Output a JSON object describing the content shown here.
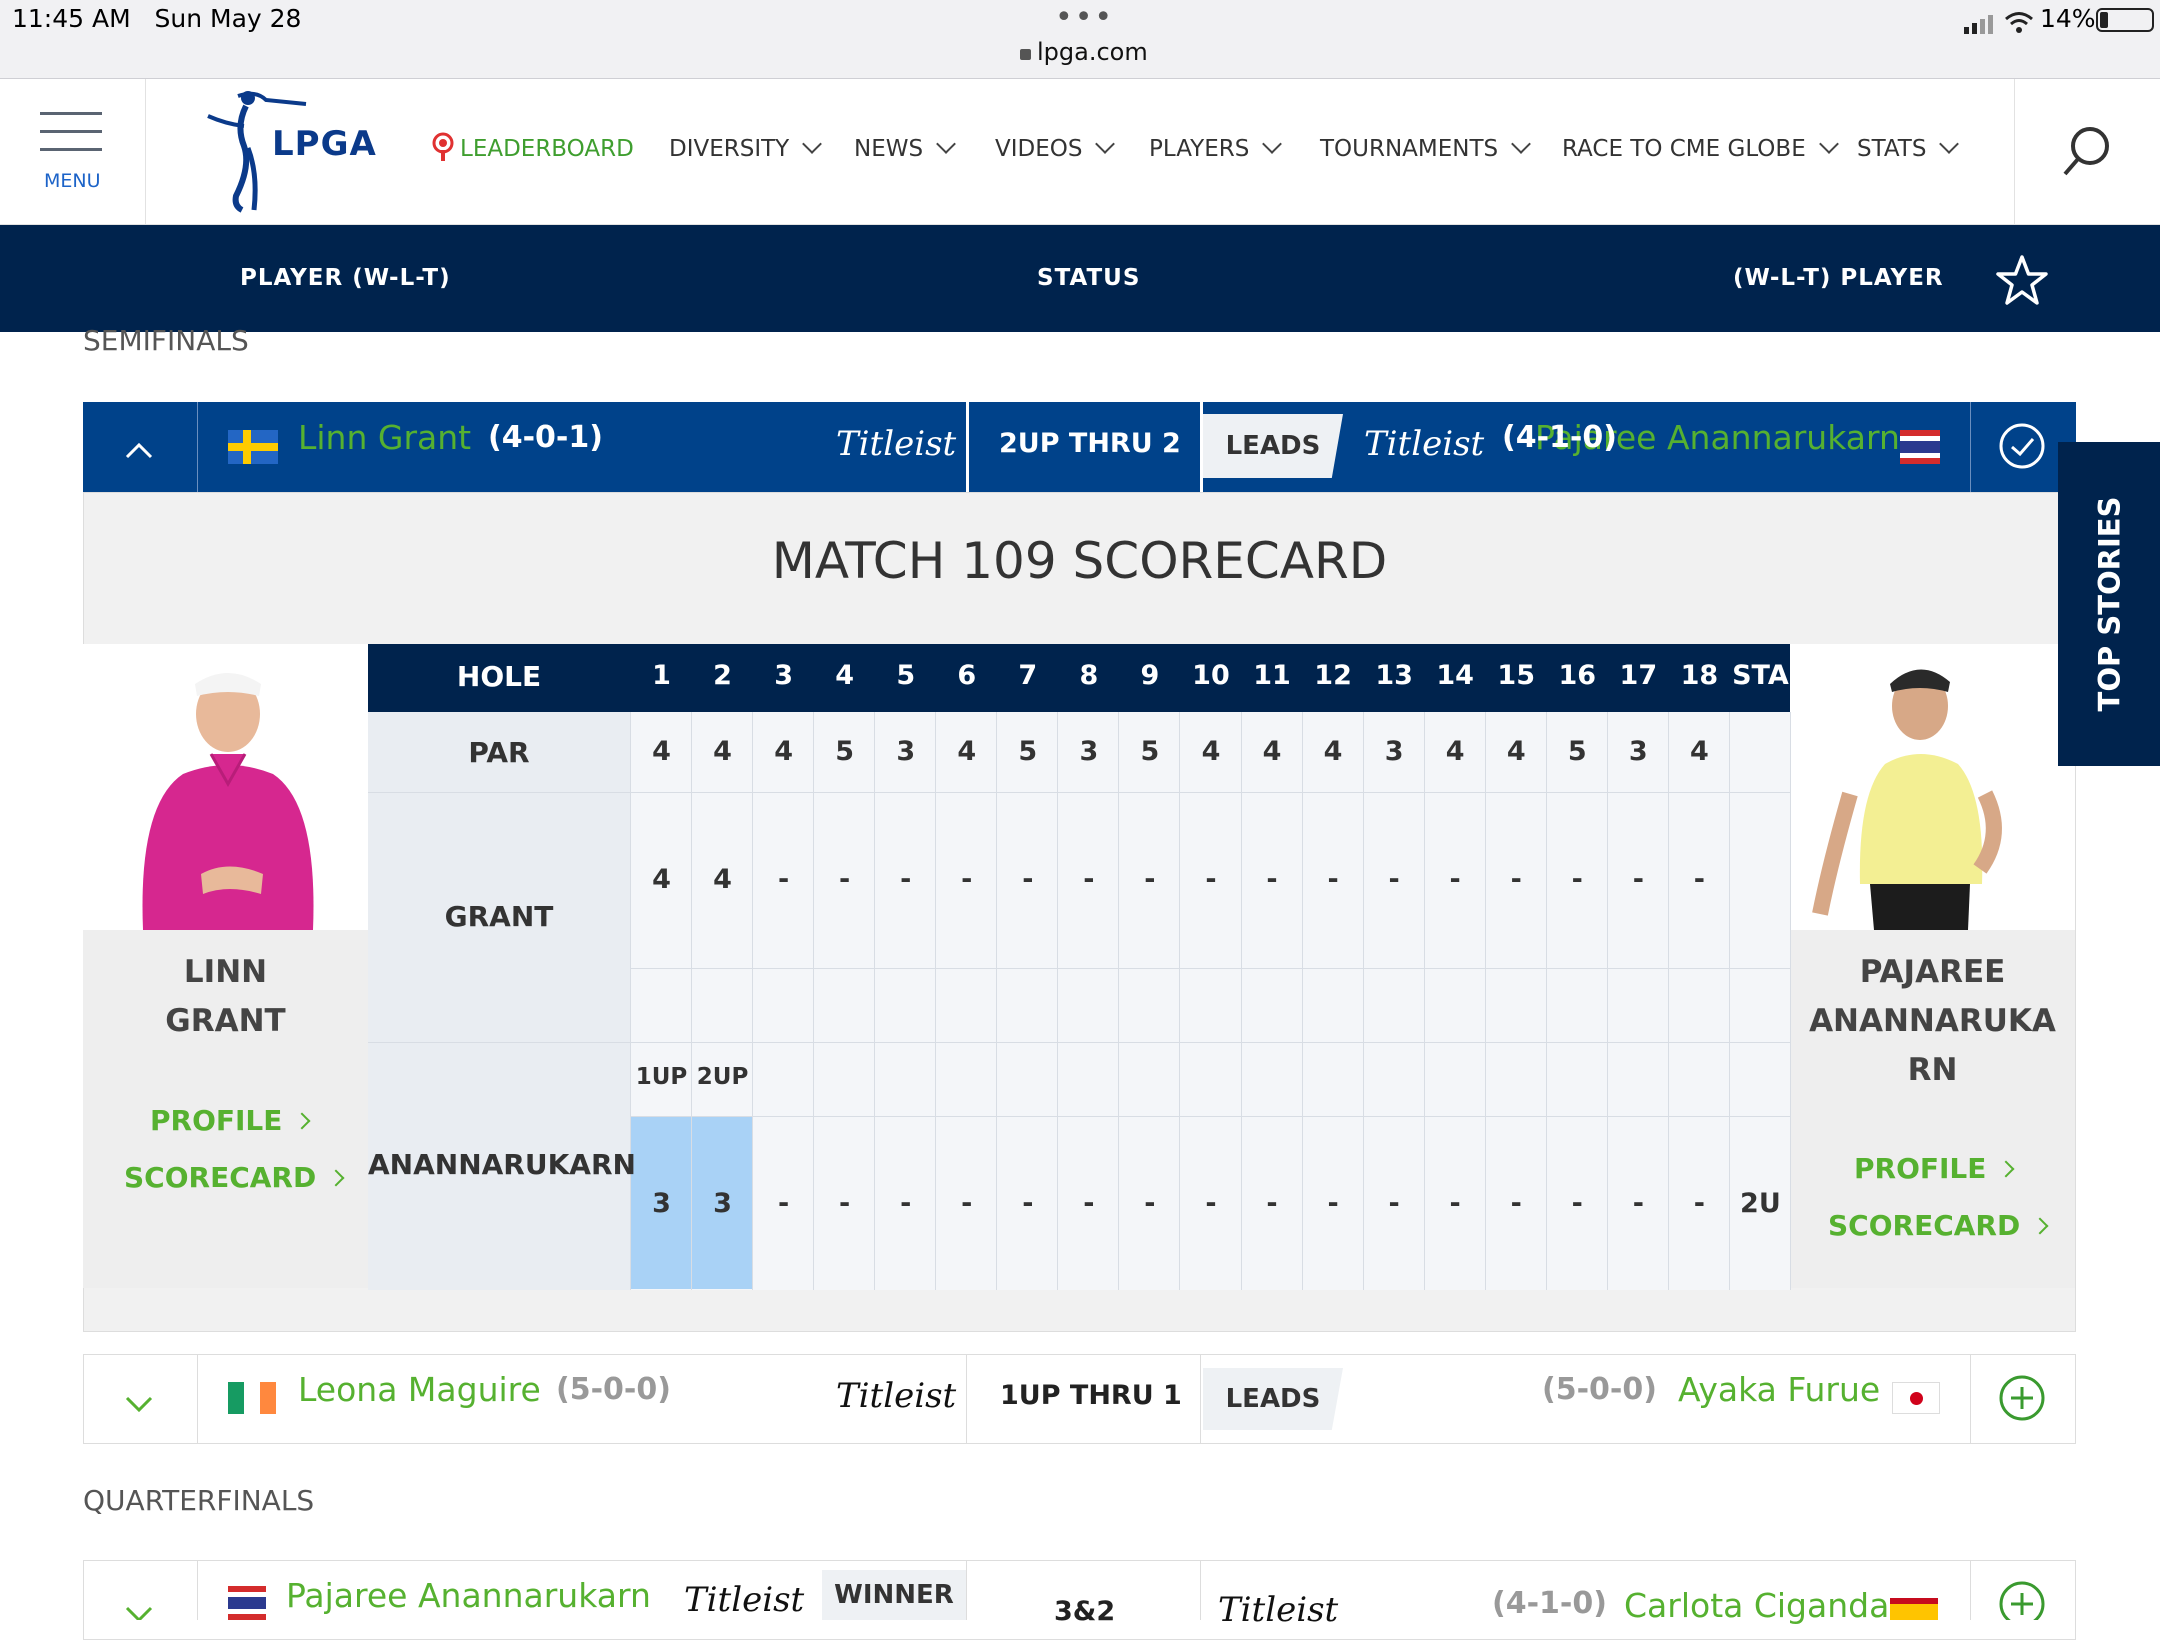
{
  "status_bar": {
    "time": "11:45 AM",
    "date": "Sun May 28",
    "dots": "•••",
    "url": "lpga.com",
    "battery": "14%"
  },
  "header": {
    "menu_label": "MENU",
    "logo_text": "LPGA",
    "nav": [
      {
        "label": "LEADERBOARD"
      },
      {
        "label": "DIVERSITY"
      },
      {
        "label": "NEWS"
      },
      {
        "label": "VIDEOS"
      },
      {
        "label": "PLAYERS"
      },
      {
        "label": "TOURNAMENTS"
      },
      {
        "label": "RACE TO CME GLOBE"
      },
      {
        "label": "STATS"
      }
    ]
  },
  "column_header": {
    "left": "PLAYER (W-L-T)",
    "center": "STATUS",
    "right": "(W-L-T) PLAYER"
  },
  "sections": {
    "semifinals": "SEMIFINALS",
    "quarterfinals": "QUARTERFINALS"
  },
  "match_open": {
    "player1": "Linn Grant",
    "record1": "(4-0-1)",
    "sponsor": "Titleist",
    "status": "2UP THRU 2",
    "badge": "LEADS",
    "record2": "(4-1-0)",
    "player2": "Pajaree Anannarukarn"
  },
  "scorecard": {
    "title": "MATCH 109 SCORECARD",
    "hole_label": "HOLE",
    "holes": [
      "1",
      "2",
      "3",
      "4",
      "5",
      "6",
      "7",
      "8",
      "9",
      "10",
      "11",
      "12",
      "13",
      "14",
      "15",
      "16",
      "17",
      "18",
      "STA"
    ],
    "par_label": "PAR",
    "par": [
      "4",
      "4",
      "4",
      "5",
      "3",
      "4",
      "5",
      "3",
      "5",
      "4",
      "4",
      "4",
      "3",
      "4",
      "4",
      "5",
      "3",
      "4"
    ],
    "grant_label": "GRANT",
    "grant": [
      "4",
      "4",
      "-",
      "-",
      "-",
      "-",
      "-",
      "-",
      "-",
      "-",
      "-",
      "-",
      "-",
      "-",
      "-",
      "-",
      "-",
      "-"
    ],
    "status_row": [
      "1UP",
      "2UP"
    ],
    "anan_label": "ANANNARUKARN",
    "anan": [
      "3",
      "3",
      "-",
      "-",
      "-",
      "-",
      "-",
      "-",
      "-",
      "-",
      "-",
      "-",
      "-",
      "-",
      "-",
      "-",
      "-",
      "-"
    ],
    "anan_status_partial": "2U",
    "left_player": {
      "first": "LINN",
      "last": "GRANT",
      "profile": "PROFILE",
      "scorecard": "SCORECARD"
    },
    "right_player": {
      "line1": "PAJAREE",
      "line2": "ANANNARUKA",
      "line3": "RN",
      "profile": "PROFILE",
      "scorecard": "SCORECARD"
    }
  },
  "match2": {
    "player1": "Leona Maguire",
    "record1": "(5-0-0)",
    "sponsor": "Titleist",
    "status": "1UP THRU 1",
    "badge": "LEADS",
    "record2": "(5-0-0)",
    "player2": "Ayaka Furue"
  },
  "match3": {
    "player1": "Pajaree Anannarukarn",
    "sponsor": "Titleist",
    "badge": "WINNER",
    "status": "3&2",
    "sponsor2": "Titleist",
    "record2": "(4-1-0)",
    "player2": "Carlota Ciganda"
  },
  "side_tab": "TOP STORIES",
  "colors": {
    "navy": "#00234d",
    "row_blue": "#00428a",
    "green": "#56b130",
    "highlight": "#a9d2f6"
  },
  "icons": [
    "lock-icon",
    "signal-icon",
    "wifi-icon",
    "battery-icon",
    "hamburger-icon",
    "search-icon",
    "star-icon",
    "chevron-up-icon",
    "check-circle-icon",
    "chevron-down-icon",
    "plus-circle-icon",
    "live-icon"
  ]
}
